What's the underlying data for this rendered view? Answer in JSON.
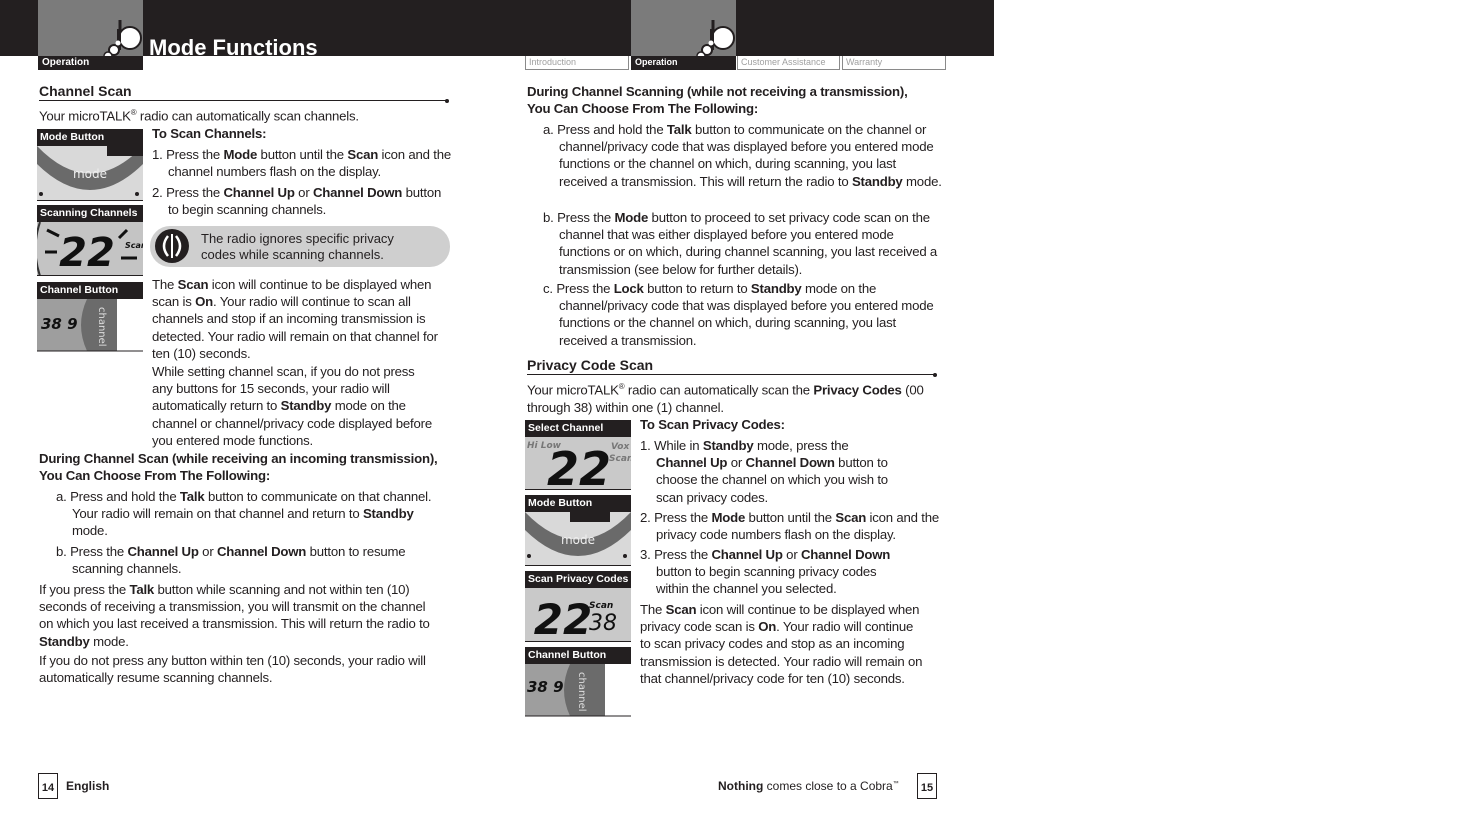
{
  "header": {
    "left_tab": "Operation",
    "title": "Mode Functions",
    "right_nav": [
      {
        "label": "Introduction",
        "active": false
      },
      {
        "label": "Operation",
        "active": true
      },
      {
        "label": "Customer Assistance",
        "active": false
      },
      {
        "label": "Warranty",
        "active": false
      }
    ]
  },
  "left_page": {
    "channel_scan": {
      "heading": "Channel Scan",
      "intro_pre": "Your microTALK",
      "intro_reg": "®",
      "intro_post": " radio can automatically scan channels.",
      "steps_heading": "To Scan Channels:",
      "steps": [
        {
          "num": "1.",
          "parts": [
            "Press the ",
            "Mode",
            " button until the ",
            "Scan",
            " icon and the channel numbers flash on the display."
          ]
        },
        {
          "num": "2.",
          "parts": [
            "Press the ",
            "Channel Up",
            " or ",
            "Channel Down",
            " button to begin scanning channels."
          ]
        }
      ],
      "note": "The radio ignores specific privacy codes while scanning channels.",
      "para1": [
        "The ",
        "Scan",
        " icon will continue to be displayed when scan is ",
        "On",
        ". Your radio will continue to scan all channels and stop if an incoming transmission is detected. Your radio will remain on that channel for ten (10) seconds."
      ],
      "para2": [
        "While setting channel scan, if you do not press any buttons for 15 seconds, your radio will automatically return to ",
        "Standby",
        " mode on the channel or channel/privacy code displayed before you entered mode functions."
      ]
    },
    "thumbnails": [
      {
        "caption": "Mode Button",
        "label": "mode"
      },
      {
        "caption": "Scanning Channels",
        "display": "22",
        "label": "Scan"
      },
      {
        "caption": "Channel Button",
        "display": "38 9",
        "label": "channel"
      }
    ],
    "during_scan": {
      "heading_line1": "During Channel Scan (while receiving an incoming transmission),",
      "heading_line2": "You Can Choose From The Following:",
      "items": [
        {
          "letter": "a.",
          "parts": [
            "Press and hold the ",
            "Talk",
            " button to communicate on that channel. Your radio will remain on that channel and return to ",
            "Standby",
            " mode."
          ]
        },
        {
          "letter": "b.",
          "parts": [
            "Press the ",
            "Channel Up",
            " or ",
            "Channel Down",
            " button to resume scanning channels."
          ]
        }
      ],
      "para1": [
        "If you press the ",
        "Talk",
        " button while scanning and not within ten (10) seconds of receiving a transmission, you will transmit on the channel on which you last received a transmission. This will return the radio to ",
        "Standby",
        " mode."
      ],
      "para2": "If you do not press any button within ten (10) seconds, your radio will automatically resume scanning channels."
    },
    "footer": {
      "page": "14",
      "label": "English"
    }
  },
  "right_page": {
    "during_scanning": {
      "heading_line1": "During Channel Scanning (while not receiving a transmission),",
      "heading_line2": "You Can Choose From The Following:",
      "items": [
        {
          "letter": "a.",
          "parts": [
            "Press and hold the ",
            "Talk",
            " button to communicate on the channel or channel/privacy code that was displayed before you entered mode functions or the channel on which, during scanning, you last received a transmission. This will return the radio to ",
            "Standby",
            " mode."
          ]
        },
        {
          "letter": "b.",
          "parts": [
            "Press the ",
            "Mode",
            " button to proceed to set privacy code scan on the channel that was either displayed before you entered mode functions or on which, during channel scanning, you last received a transmission (see below for further details)."
          ]
        },
        {
          "letter": "c.",
          "parts": [
            "Press the ",
            "Lock",
            " button to return to ",
            "Standby",
            " mode on the channel/privacy code that was displayed before you entered mode functions or the channel on which, during scanning, you last received a transmission."
          ]
        }
      ]
    },
    "privacy_scan": {
      "heading": "Privacy Code Scan",
      "intro": [
        "Your microTALK",
        "®",
        " radio can automatically scan the ",
        "Privacy Codes",
        " (00 through 38) within one (1) channel."
      ],
      "steps_heading": "To Scan Privacy Codes:",
      "steps": [
        {
          "num": "1.",
          "parts": [
            "While in ",
            "Standby",
            " mode, press the ",
            "Channel Up",
            " or ",
            "Channel Down",
            " button to choose the channel on which you wish to scan privacy codes."
          ]
        },
        {
          "num": "2.",
          "parts": [
            "Press the ",
            "Mode",
            " button until the ",
            "Scan",
            " icon and the privacy code numbers flash on the display."
          ]
        },
        {
          "num": "3.",
          "parts": [
            "Press the ",
            "Channel Up",
            " or ",
            "Channel Down",
            " button to begin scanning privacy codes within the channel you selected."
          ]
        }
      ],
      "para": [
        "The ",
        "Scan",
        " icon will continue to be displayed when privacy code scan is ",
        "On",
        ". Your radio will continue to scan privacy codes and stop as an incoming transmission is detected. Your radio will remain on that channel/privacy code for ten (10) seconds."
      ]
    },
    "thumbnails": [
      {
        "caption": "Select Channel",
        "display": "22",
        "label": "Vox Scan"
      },
      {
        "caption": "Mode Button",
        "label": "mode"
      },
      {
        "caption": "Scan Privacy Codes",
        "display": "22",
        "sub": "38",
        "label": "Scan"
      },
      {
        "caption": "Channel Button",
        "display": "38 9",
        "label": "channel"
      }
    ],
    "footer": {
      "slogan_bold": "Nothing",
      "slogan_rest": " comes close to a Cobra",
      "tm": "™",
      "page": "15"
    }
  },
  "colors": {
    "band": "#231f20",
    "tab_gray": "#7b7b7b",
    "note_bg": "#cfcfcf",
    "nav_inactive": "#a0a0a0"
  }
}
